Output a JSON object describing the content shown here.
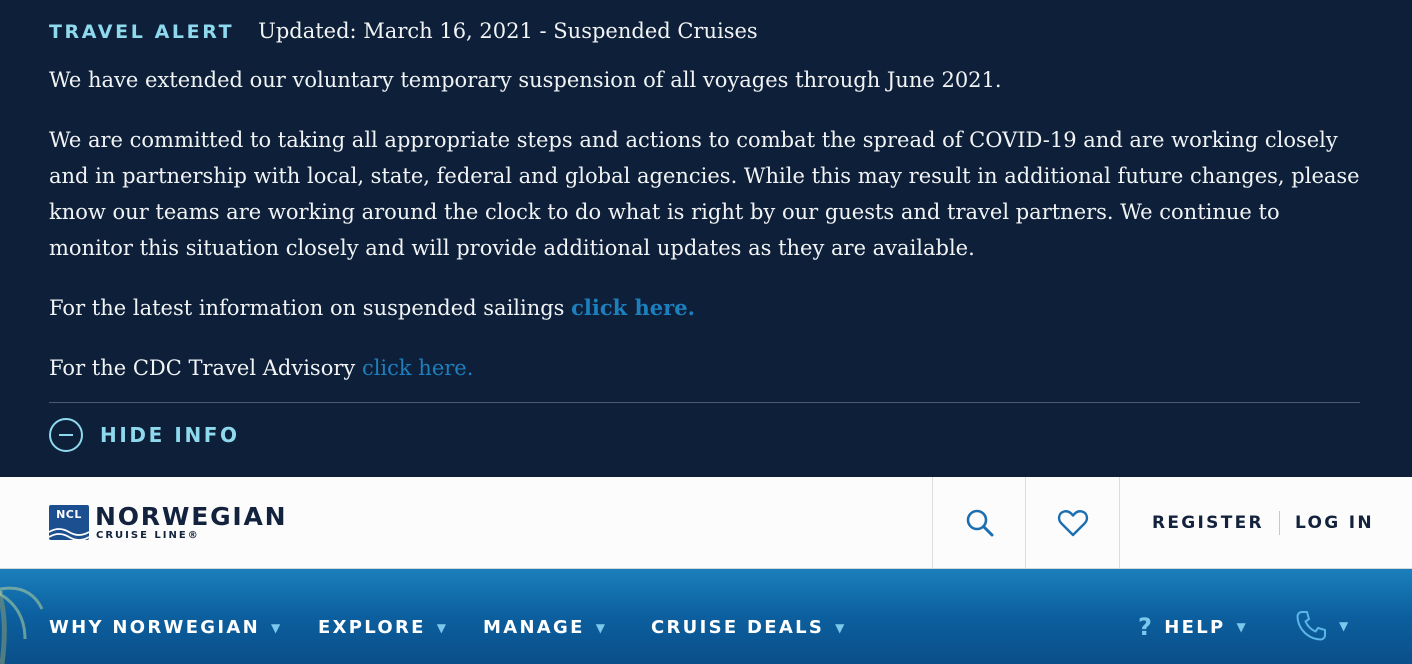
{
  "alert": {
    "tag": "TRAVEL ALERT",
    "updated": "Updated: March 16, 2021 - Suspended Cruises",
    "paragraph1": "We have extended our voluntary temporary suspension of all voyages through June 2021.",
    "paragraph2": "We are committed to taking all appropriate steps and actions to combat the spread of COVID-19 and are working closely and in partnership with local, state, federal and global agencies. While this may result in additional future changes, please know our teams are working around the clock to do what is right by our guests and travel partners. We continue to monitor this situation closely and will provide additional updates as they are available.",
    "latest_text": "For the latest information on suspended sailings ",
    "latest_link": "click here.",
    "cdc_text": "For the CDC Travel Advisory ",
    "cdc_link": "click here.",
    "hide_label": "HIDE INFO"
  },
  "header": {
    "logo_badge": "NCL",
    "logo_main": "NORWEGIAN",
    "logo_sub": "CRUISE LINE®",
    "search_icon": "search-icon",
    "heart_icon": "heart-icon",
    "register_label": "REGISTER",
    "login_label": "LOG IN"
  },
  "nav": {
    "items": [
      {
        "label": "WHY NORWEGIAN",
        "caret": "▼"
      },
      {
        "label": "EXPLORE",
        "caret": "▼"
      },
      {
        "label": "MANAGE",
        "caret": "▼"
      },
      {
        "label": "CRUISE DEALS",
        "caret": "▼"
      }
    ],
    "help_icon": "?",
    "help_label": "HELP",
    "help_caret": "▼",
    "phone_icon": "phone-icon",
    "phone_caret": "▼"
  },
  "colors": {
    "alert_bg": "#0e2039",
    "accent_cyan": "#8fd9ee",
    "link_blue": "#1d7fbd",
    "brand_navy": "#13233d",
    "nav_blue": "#0c5f9e"
  }
}
